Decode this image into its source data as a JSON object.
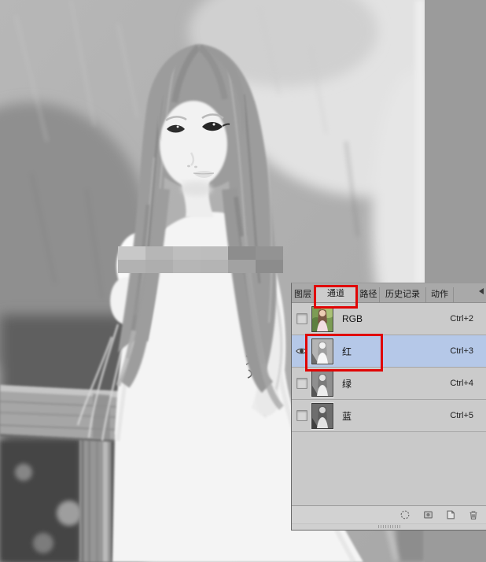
{
  "panel": {
    "tabs": [
      {
        "label": "图层",
        "active": false
      },
      {
        "label": "通道",
        "active": true
      },
      {
        "label": "路径",
        "active": false
      },
      {
        "label": "历史记录",
        "active": false
      },
      {
        "label": "动作",
        "active": false
      }
    ],
    "channels": [
      {
        "name": "RGB",
        "shortcut": "Ctrl+2",
        "visible": false,
        "selected": false
      },
      {
        "name": "红",
        "shortcut": "Ctrl+3",
        "visible": true,
        "selected": true
      },
      {
        "name": "绿",
        "shortcut": "Ctrl+4",
        "visible": false,
        "selected": false
      },
      {
        "name": "蓝",
        "shortcut": "Ctrl+5",
        "visible": false,
        "selected": false
      }
    ],
    "footer_icons": [
      {
        "name": "load-channel-as-selection"
      },
      {
        "name": "save-selection-as-channel"
      },
      {
        "name": "create-new-channel"
      },
      {
        "name": "delete-current-channel"
      }
    ]
  },
  "annotations": {
    "color": "#e00505",
    "boxes": [
      {
        "target": "channels-tab"
      },
      {
        "target": "red-channel-row"
      }
    ]
  },
  "colors": {
    "selected_row_highlight": "#b5c8e8",
    "panel_background": "#cbcbcb",
    "workspace_background": "#9b9b9b",
    "annotation_red": "#e00505"
  }
}
